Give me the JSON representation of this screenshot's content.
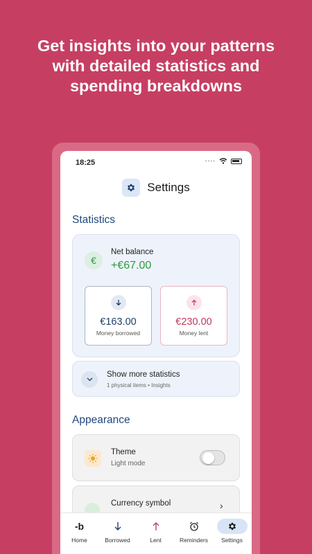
{
  "headline": {
    "line1": "Get insights into your patterns",
    "line2": "with detailed statistics and",
    "line3": "spending breakdowns"
  },
  "status_bar": {
    "time": "18:25"
  },
  "header": {
    "title": "Settings",
    "icon": "gear-icon"
  },
  "statistics": {
    "section_title": "Statistics",
    "net_balance": {
      "label": "Net balance",
      "value": "+€67.00",
      "icon_glyph": "€"
    },
    "borrowed": {
      "value": "€163.00",
      "label": "Money borrowed"
    },
    "lent": {
      "value": "€230.00",
      "label": "Money lent"
    },
    "more": {
      "title": "Show more statistics",
      "subtitle": "1 physical items • Insights"
    }
  },
  "appearance": {
    "section_title": "Appearance",
    "theme": {
      "title": "Theme",
      "subtitle": "Light mode",
      "toggle_on": false
    },
    "currency": {
      "title": "Currency symbol"
    }
  },
  "nav": {
    "items": [
      {
        "label": "Home",
        "icon": "logo-b-icon"
      },
      {
        "label": "Borrowed",
        "icon": "arrow-down-icon"
      },
      {
        "label": "Lent",
        "icon": "arrow-up-icon"
      },
      {
        "label": "Reminders",
        "icon": "alarm-clock-icon"
      },
      {
        "label": "Settings",
        "icon": "gear-icon",
        "active": true
      }
    ]
  },
  "colors": {
    "background": "#c63f63",
    "accent_blue": "#20477d",
    "positive_green": "#2f9a44",
    "lent_pink": "#c0395d"
  }
}
